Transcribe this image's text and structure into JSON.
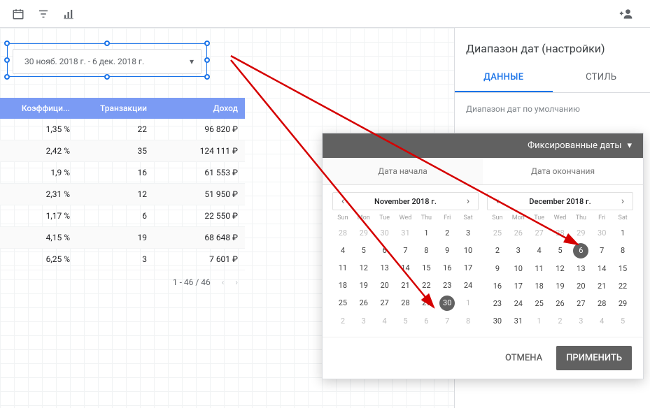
{
  "toolbar": {},
  "widget": {
    "date_range_text": "30 нояб. 2018 г. - 6 дек. 2018 г."
  },
  "table": {
    "headers": {
      "coef": "Коэффици...",
      "trans": "Транзакции",
      "income": "Доход"
    },
    "rows": [
      {
        "coef": "1,35 %",
        "trans": "22",
        "income": "96 820 ₽"
      },
      {
        "coef": "2,42 %",
        "trans": "35",
        "income": "124 111 ₽"
      },
      {
        "coef": "1,9 %",
        "trans": "16",
        "income": "61 553 ₽"
      },
      {
        "coef": "2,31 %",
        "trans": "12",
        "income": "51 950 ₽"
      },
      {
        "coef": "1,17 %",
        "trans": "6",
        "income": "22 550 ₽"
      },
      {
        "coef": "4,15 %",
        "trans": "19",
        "income": "68 648 ₽"
      },
      {
        "coef": "6,25 %",
        "trans": "3",
        "income": "7 601 ₽"
      }
    ],
    "pager": "1 - 46 / 46"
  },
  "sidebar": {
    "title": "Диапазон дат (настройки)",
    "tabs": {
      "data": "ДАННЫЕ",
      "style": "СТИЛЬ"
    },
    "default_range_label": "Диапазон дат по умолчанию"
  },
  "datepicker": {
    "mode_label": "Фиксированные даты",
    "start_tab": "Дата начала",
    "end_tab": "Дата окончания",
    "weekdays": [
      "Sun",
      "Mon",
      "Tue",
      "Wed",
      "Thu",
      "Fri",
      "Sat"
    ],
    "months": {
      "left": {
        "title": "November 2018 г.",
        "selected": 30,
        "leading": [
          28,
          29,
          30,
          31
        ],
        "days": 30,
        "trailing": [
          1,
          2,
          3,
          4,
          5,
          6,
          7,
          8
        ]
      },
      "right": {
        "title": "December 2018 г.",
        "selected": 6,
        "leading": [
          25,
          26,
          27,
          28,
          29,
          30
        ],
        "days": 31,
        "trailing": [
          1,
          2,
          3,
          4,
          5
        ]
      }
    },
    "cancel": "ОТМЕНА",
    "apply": "ПРИМЕНИТЬ"
  }
}
